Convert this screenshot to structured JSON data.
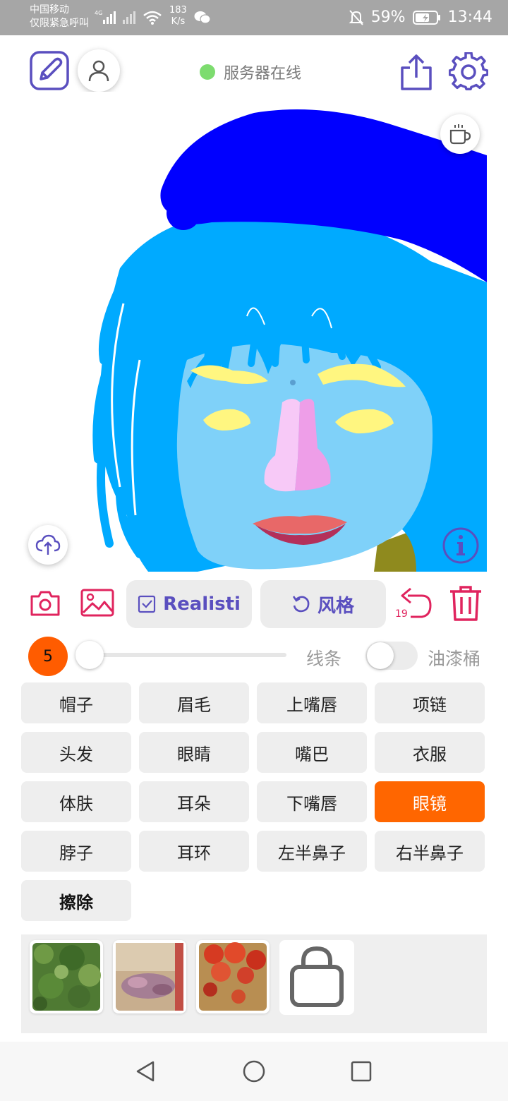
{
  "status_bar": {
    "carrier_line1": "中国移动",
    "carrier_line2": "仅限紧急呼叫",
    "net_speed": "183",
    "net_unit": "K/s",
    "signal_label": "4G",
    "battery": "59%",
    "time": "13:44"
  },
  "header": {
    "server_status": "服务器在线",
    "server_color": "#7ddc6f",
    "icons": [
      "edit-icon",
      "user-icon",
      "share-icon",
      "settings-icon"
    ]
  },
  "canvas": {
    "float_icons": [
      "coffee-icon",
      "upload-cloud-icon",
      "info-icon"
    ],
    "colors": {
      "hat": "#0000ff",
      "hair": "#00aaff",
      "skin": "#7fd1f9",
      "eyebrow": "#fff680",
      "eyes": "#fff680",
      "nose_left": "#f7c9f7",
      "nose_right": "#ee9ee8",
      "upper_lip": "#e86868",
      "lower_lip": "#b3305a",
      "clothes": "#8f8a1e"
    }
  },
  "actions": {
    "style_mode": "Realisti",
    "style_button": "风格",
    "undo_count": "19",
    "icons": [
      "camera-icon",
      "image-icon",
      "undo-icon",
      "trash-icon"
    ]
  },
  "brush": {
    "size": "5",
    "line_label": "线条",
    "bucket_label": "油漆桶",
    "bucket_enabled": false
  },
  "labels": [
    {
      "text": "帽子",
      "active": false
    },
    {
      "text": "眉毛",
      "active": false
    },
    {
      "text": "上嘴唇",
      "active": false
    },
    {
      "text": "项链",
      "active": false
    },
    {
      "text": "头发",
      "active": false
    },
    {
      "text": "眼睛",
      "active": false
    },
    {
      "text": "嘴巴",
      "active": false
    },
    {
      "text": "衣服",
      "active": false
    },
    {
      "text": "体肤",
      "active": false
    },
    {
      "text": "耳朵",
      "active": false
    },
    {
      "text": "下嘴唇",
      "active": false
    },
    {
      "text": "眼镜",
      "active": true
    },
    {
      "text": "脖子",
      "active": false
    },
    {
      "text": "耳环",
      "active": false
    },
    {
      "text": "左半鼻子",
      "active": false
    },
    {
      "text": "右半鼻子",
      "active": false
    },
    {
      "text": "擦除",
      "active": false
    }
  ],
  "active_color": "#ff6600",
  "style_thumbnails": [
    "green-foliage-thumbnail",
    "textured-pink-thumbnail",
    "red-flowers-thumbnail",
    "shopping-bag-icon"
  ],
  "nav": [
    "back-icon",
    "home-icon",
    "recents-icon"
  ]
}
